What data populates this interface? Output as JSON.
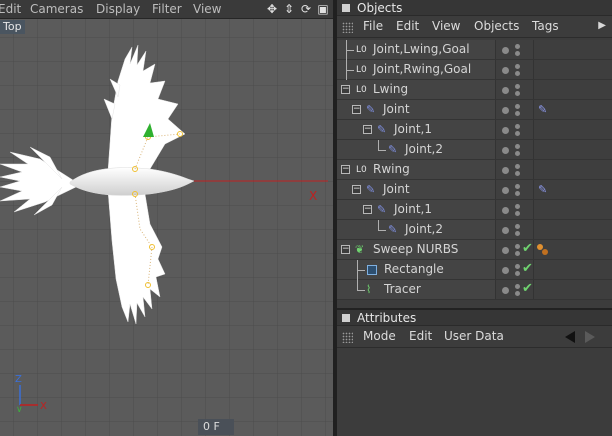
{
  "viewport": {
    "menu": [
      "Edit",
      "Cameras",
      "Display",
      "Filter",
      "View"
    ],
    "label": "Top",
    "axis_x": "X",
    "axis_z": "Z",
    "gizmo_x": "X",
    "frame": "0 F"
  },
  "objects_panel": {
    "title": "Objects",
    "menu": [
      "File",
      "Edit",
      "View",
      "Objects",
      "Tags"
    ],
    "rows": [
      {
        "name": "Joint,Lwing,Goal"
      },
      {
        "name": "Joint,Rwing,Goal"
      },
      {
        "name": "Lwing"
      },
      {
        "name": "Joint"
      },
      {
        "name": "Joint,1"
      },
      {
        "name": "Joint,2"
      },
      {
        "name": "Rwing"
      },
      {
        "name": "Joint"
      },
      {
        "name": "Joint,1"
      },
      {
        "name": "Joint,2"
      },
      {
        "name": "Sweep NURBS"
      },
      {
        "name": "Rectangle"
      },
      {
        "name": "Tracer"
      }
    ]
  },
  "attributes_panel": {
    "title": "Attributes",
    "menu": [
      "Mode",
      "Edit",
      "User Data"
    ]
  },
  "colors": {
    "viewport_bg": "#5b5b5b",
    "grid": "#4c4c4c",
    "x_axis": "#c02020",
    "check": "#6fd36f"
  }
}
